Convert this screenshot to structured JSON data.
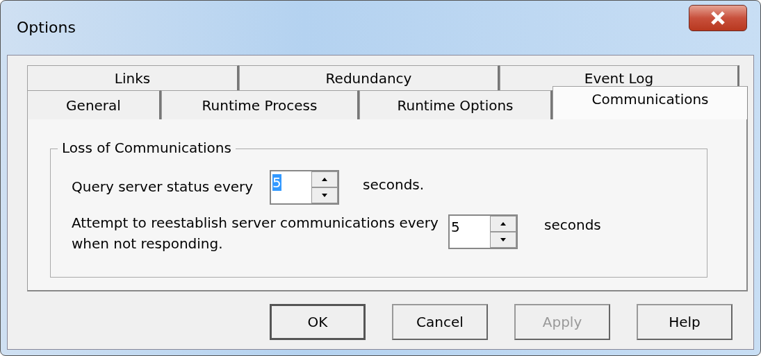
{
  "window": {
    "title": "Options"
  },
  "tab_rows": [
    [
      {
        "label": "Links",
        "selected": false
      },
      {
        "label": "Redundancy",
        "selected": false
      },
      {
        "label": "Event Log",
        "selected": false
      }
    ],
    [
      {
        "label": "General",
        "selected": false
      },
      {
        "label": "Runtime Process",
        "selected": false
      },
      {
        "label": "Runtime Options",
        "selected": false
      },
      {
        "label": "Communications",
        "selected": true
      }
    ]
  ],
  "group": {
    "title": "Loss of Communications",
    "settings": [
      {
        "label": "Query server status every",
        "value": "5",
        "value_highlighted": true,
        "unit": "seconds."
      },
      {
        "label": "Attempt to reestablish server communications every",
        "value": "5",
        "value_highlighted": false,
        "unit": "seconds",
        "note": "when not responding."
      }
    ]
  },
  "buttons": [
    {
      "label": "OK",
      "disabled": false,
      "default": true
    },
    {
      "label": "Cancel",
      "disabled": false,
      "default": false
    },
    {
      "label": "Apply",
      "disabled": true,
      "default": false
    },
    {
      "label": "Help",
      "disabled": false,
      "default": false
    }
  ]
}
